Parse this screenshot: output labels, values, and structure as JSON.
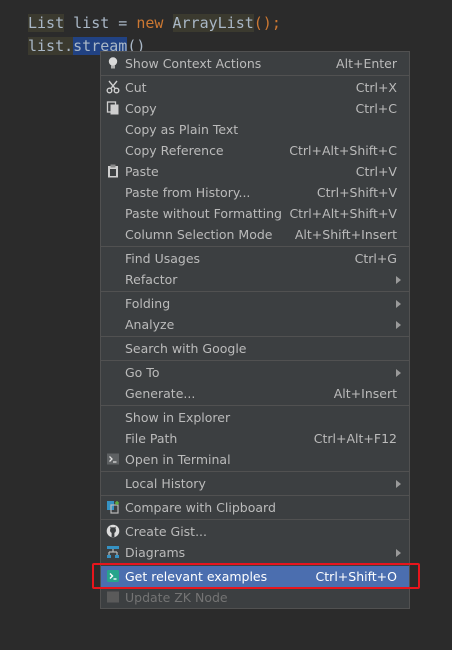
{
  "code": {
    "line1": {
      "t1": "List",
      "t2": " list = ",
      "t3": "new",
      "t4": " ",
      "t5": "ArrayList",
      "t6": "();"
    },
    "line2": {
      "t1": "list.",
      "t2": "stream",
      "t3": "()"
    }
  },
  "menu": {
    "show_context_actions": {
      "label": "Show Context Actions",
      "shortcut": "Alt+Enter",
      "icon": "bulb-icon"
    },
    "cut": {
      "label": "Cut",
      "shortcut": "Ctrl+X",
      "icon": "scissors-icon"
    },
    "copy": {
      "label": "Copy",
      "shortcut": "Ctrl+C",
      "icon": "copy-icon"
    },
    "copy_plain": {
      "label": "Copy as Plain Text"
    },
    "copy_reference": {
      "label": "Copy Reference",
      "shortcut": "Ctrl+Alt+Shift+C"
    },
    "paste": {
      "label": "Paste",
      "shortcut": "Ctrl+V",
      "icon": "clipboard-icon"
    },
    "paste_history": {
      "label": "Paste from History...",
      "shortcut": "Ctrl+Shift+V"
    },
    "paste_noformat": {
      "label": "Paste without Formatting",
      "shortcut": "Ctrl+Alt+Shift+V"
    },
    "column_selection": {
      "label": "Column Selection Mode",
      "shortcut": "Alt+Shift+Insert"
    },
    "find_usages": {
      "label": "Find Usages",
      "shortcut": "Ctrl+G"
    },
    "refactor": {
      "label": "Refactor"
    },
    "folding": {
      "label": "Folding"
    },
    "analyze": {
      "label": "Analyze"
    },
    "search_google": {
      "label": "Search with Google"
    },
    "go_to": {
      "label": "Go To"
    },
    "generate": {
      "label": "Generate...",
      "shortcut": "Alt+Insert"
    },
    "show_explorer": {
      "label": "Show in Explorer"
    },
    "file_path": {
      "label": "File Path",
      "shortcut": "Ctrl+Alt+F12"
    },
    "open_terminal": {
      "label": "Open in Terminal",
      "icon": "terminal-icon"
    },
    "local_history": {
      "label": "Local History"
    },
    "compare_clipboard": {
      "label": "Compare with Clipboard",
      "icon": "compare-icon"
    },
    "create_gist": {
      "label": "Create Gist...",
      "icon": "github-icon"
    },
    "diagrams": {
      "label": "Diagrams",
      "icon": "diagram-icon"
    },
    "relevant_examples": {
      "label": "Get relevant examples",
      "shortcut": "Ctrl+Shift+O",
      "icon": "terminal-plugin-icon"
    },
    "update_zk": {
      "label": "Update ZK Node",
      "icon": "zk-node-icon"
    }
  },
  "colors": {
    "active_bg": "#4b6eaf",
    "highlight_border": "#e8151c",
    "menu_bg": "#3c3f41"
  }
}
